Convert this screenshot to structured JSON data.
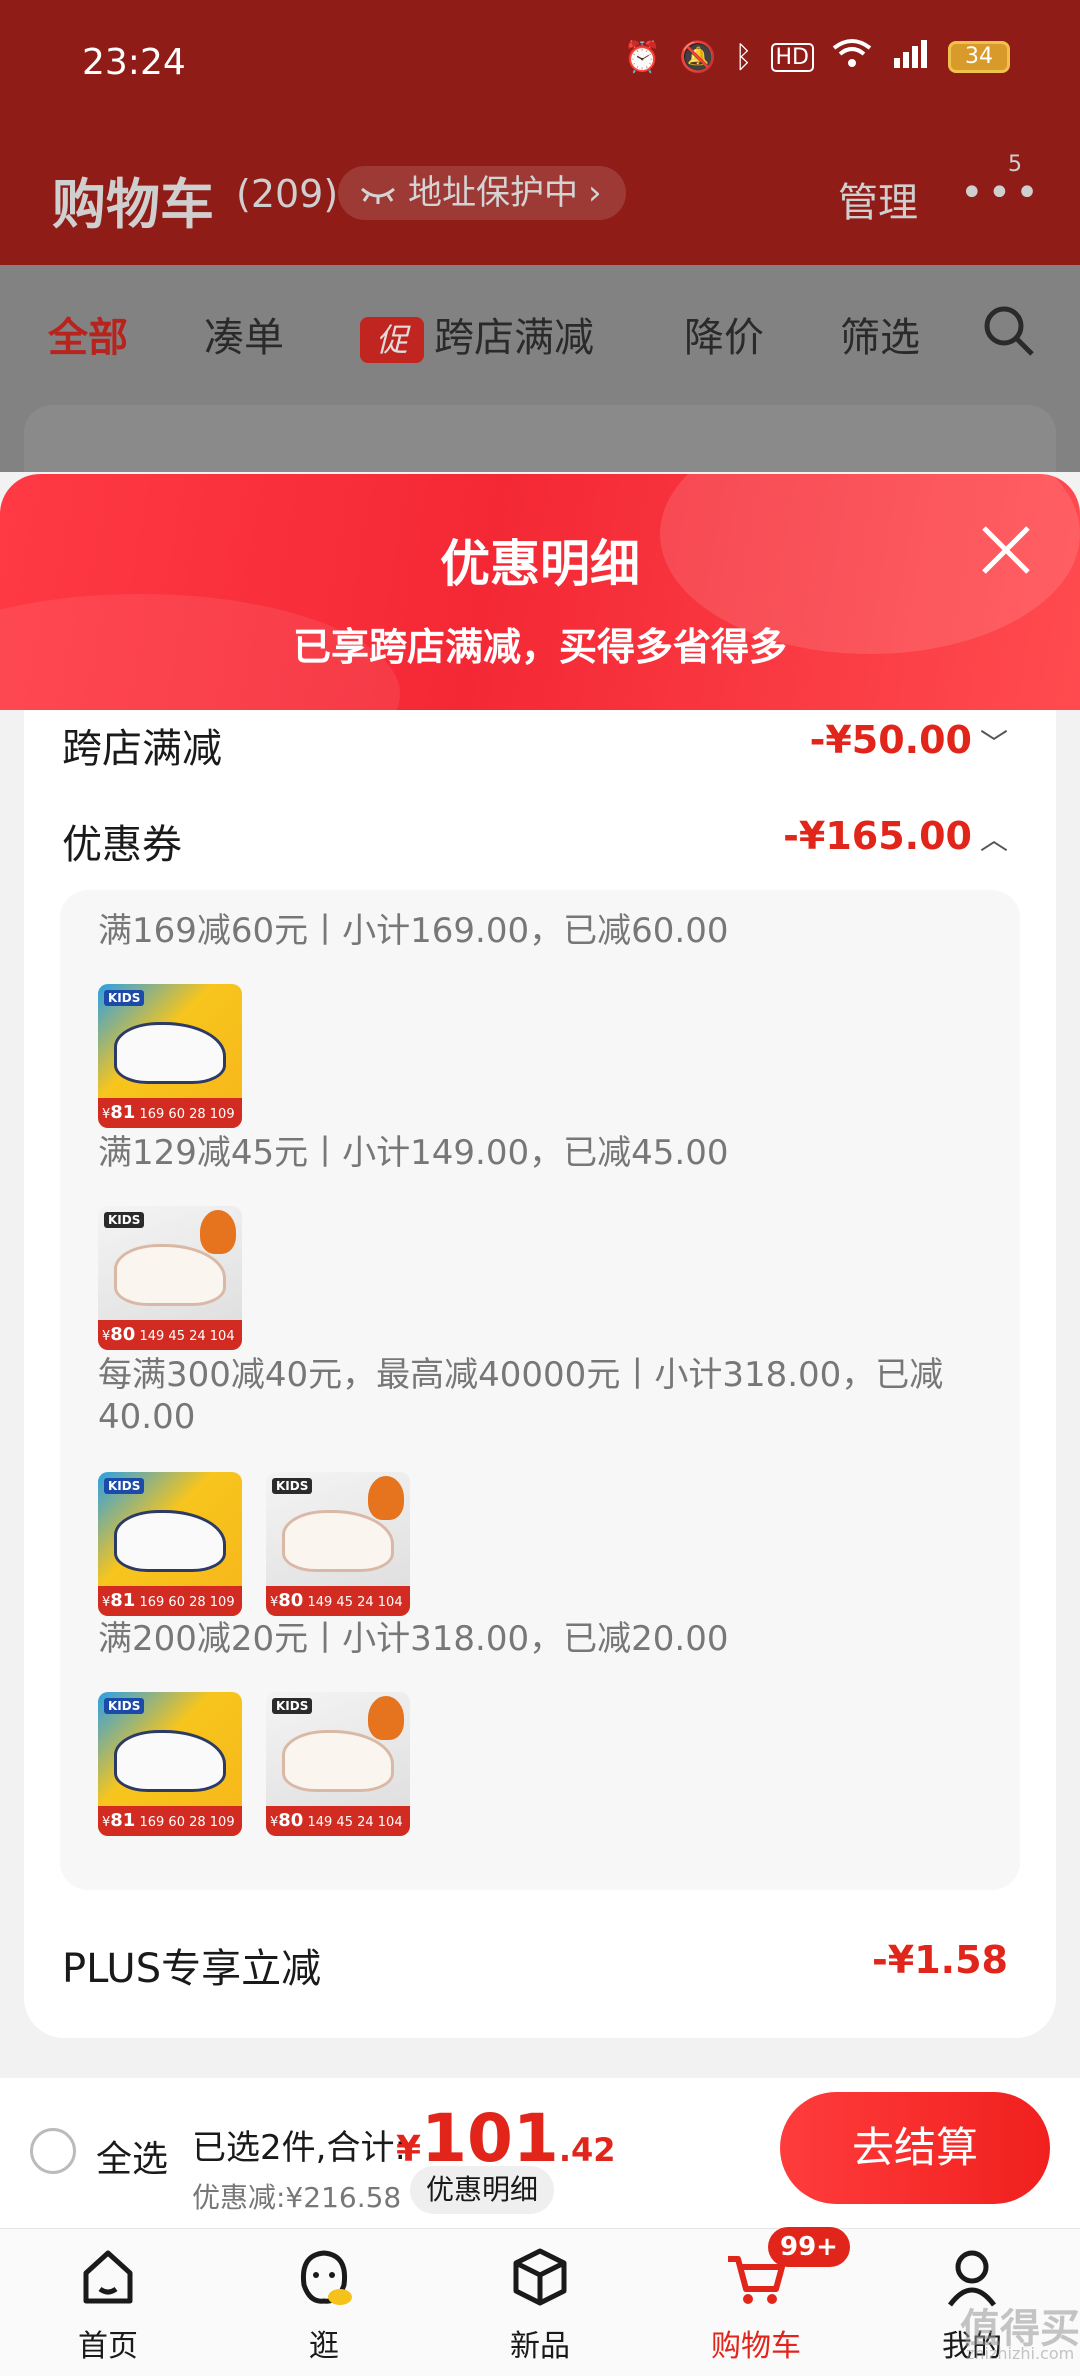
{
  "status_bar": {
    "time": "23:24",
    "battery": "34"
  },
  "header": {
    "title": "购物车",
    "count": "(209)",
    "address_chip": "地址保护中",
    "manage": "管理",
    "more_badge": "5"
  },
  "filters": {
    "all": "全部",
    "bundle": "凑单",
    "promo_tag": "促",
    "cross_store": "跨店满减",
    "price_drop": "降价",
    "filter": "筛选"
  },
  "sheet": {
    "title": "优惠明细",
    "subtitle": "已享跨店满减，买得多省得多",
    "cross_store_label": "跨店满减",
    "cross_store_amount": "-¥50.00",
    "coupon_label": "优惠券",
    "coupon_amount": "-¥165.00",
    "coupon_rules": [
      "满169减60元丨小计169.00，已减60.00",
      "满129减45元丨小计149.00，已减45.00",
      "每满300减40元，最高减40000元丨小计318.00，已减40.00",
      "满200减20元丨小计318.00，已减20.00"
    ],
    "plus_label": "PLUS专享立减",
    "plus_amount": "-¥1.58"
  },
  "products": {
    "a": {
      "brand": "KIDS",
      "price": "81",
      "strip": "169 60 28 109"
    },
    "b": {
      "brand": "KIDS",
      "price": "80",
      "strip": "149 45 24 104"
    }
  },
  "checkout": {
    "select_all": "全选",
    "selected_text": "已选2件,合计:",
    "currency": "¥",
    "total_int": "101",
    "total_dec": ".42",
    "saved": "优惠减:¥216.58",
    "detail_chip": "优惠明细",
    "checkout_button": "去结算"
  },
  "tabbar": {
    "home": "首页",
    "browse": "逛",
    "new": "新品",
    "cart": "购物车",
    "cart_badge": "99+",
    "mine": "我的"
  },
  "watermark": {
    "main": "值得买",
    "sub": "zhizhizhi.com"
  },
  "colors": {
    "accent": "#e1251b",
    "header_dim": "#8f1c17",
    "sheet_gradient": "#f42835"
  }
}
